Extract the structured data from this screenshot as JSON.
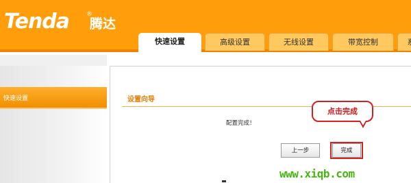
{
  "header": {
    "brand": "Tenda",
    "brand_mark": "®",
    "brand_cn": "腾达",
    "tabs": [
      {
        "label": "快速设置",
        "active": true
      },
      {
        "label": "高级设置",
        "active": false
      },
      {
        "label": "无线设置",
        "active": false
      },
      {
        "label": "带宽控制",
        "active": false
      },
      {
        "label": "系",
        "active": false
      }
    ]
  },
  "sidebar": {
    "items": [
      {
        "label": "快速设置",
        "active": true
      }
    ]
  },
  "main": {
    "section_title": "设置向导",
    "message": "配置完成！",
    "prev_button": "上一步",
    "finish_button": "完成"
  },
  "annotation": {
    "callout": "点击完成"
  },
  "watermark": "www.xiqb.com",
  "colors": {
    "header": "#ff9d0a",
    "tab_inactive": "#ffc95f",
    "accent": "#e47e00",
    "callout": "#d41f1f",
    "watermark": "#47b512"
  }
}
